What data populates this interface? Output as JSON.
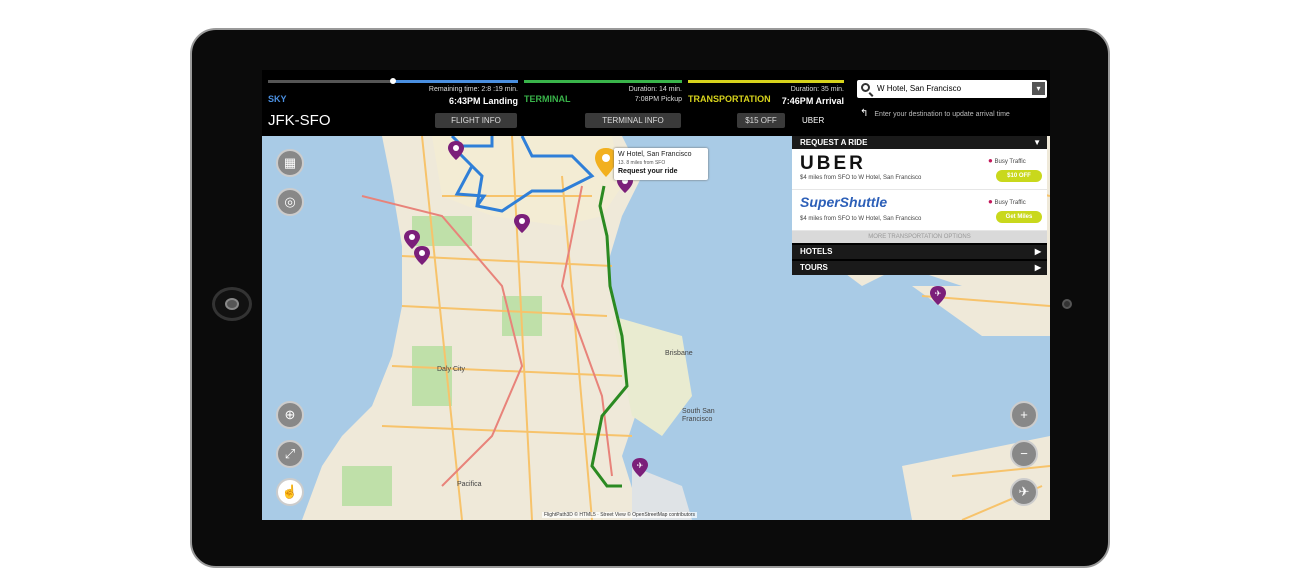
{
  "header": {
    "sky": {
      "label": "SKY",
      "remaining": "Remaining time: 2:8 :19 min.",
      "time": "6:43PM Landing",
      "color": "#4a8fe0",
      "progress": 0.5
    },
    "terminal": {
      "label": "TERMINAL",
      "duration": "Duration: 14 min.",
      "pickup": "7:08PM Pickup",
      "color": "#39b44a"
    },
    "transportation": {
      "label": "TRANSPORTATION",
      "duration": "Duration: 35 min.",
      "arrival": "7:46PM Arrival",
      "color": "#d7d31c"
    },
    "route": "JFK-SFO",
    "tabs": {
      "flight_info": "FLIGHT INFO",
      "terminal_info": "TERMINAL INFO",
      "discount": "$15 OFF",
      "uber": "UBER"
    }
  },
  "search": {
    "value": "W Hotel, San Francisco",
    "hint": "Enter your destination to update arrival time"
  },
  "map": {
    "popup": {
      "title": "W Hotel, San Francisco",
      "distance": "13. 8 miles from SFO",
      "action": "Request your ride"
    },
    "labels": {
      "daly_city": "Daly City",
      "brisbane": "Brisbane",
      "south_sf": "South San Francisco",
      "pacifica": "Pacifica"
    },
    "attribution": "FlightPath3D © HTML5 · Street View © OpenStreetMap contributors",
    "controls": [
      "map-icon",
      "locate-icon",
      "globe-icon",
      "expand-icon",
      "hand-icon",
      "zoom-in-icon",
      "zoom-out-icon",
      "airplane-icon"
    ]
  },
  "panel": {
    "request_title": "REQUEST A RIDE",
    "providers": [
      {
        "name": "UBER",
        "desc": "$4 miles from SFO to W Hotel, San Francisco",
        "traffic": "Busy Traffic",
        "action": "$10 OFF"
      },
      {
        "name": "SuperShuttle",
        "desc": "$4 miles from SFO to W Hotel, San Francisco",
        "traffic": "Busy Traffic",
        "action": "Get Miles"
      }
    ],
    "more": "MORE TRANSPORTATION OPTIONS",
    "sections": [
      "HOTELS",
      "TOURS"
    ]
  }
}
